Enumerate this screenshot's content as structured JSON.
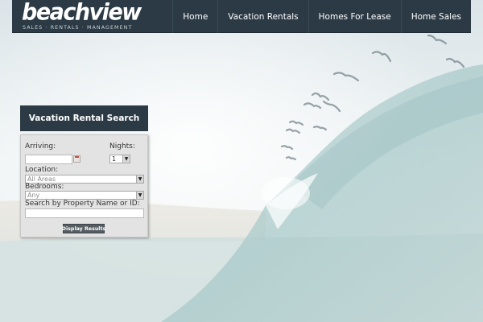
{
  "brand": {
    "logo": "beachview",
    "tagline": "SALES · RENTALS · MANAGEMENT"
  },
  "nav": {
    "items": [
      {
        "label": "Home"
      },
      {
        "label": "Vacation Rentals"
      },
      {
        "label": "Homes For Lease"
      },
      {
        "label": "Home Sales"
      }
    ]
  },
  "search": {
    "title": "Vacation Rental Search",
    "arriving_label": "Arriving:",
    "arriving_value": "",
    "nights_label": "Nights:",
    "nights_value": "1",
    "location_label": "Location:",
    "location_value": "All Areas",
    "bedrooms_label": "Bedrooms:",
    "bedrooms_value": "Any",
    "property_label": "Search by Property Name or ID:",
    "property_value": "",
    "submit_label": "Display Results"
  },
  "colors": {
    "nav_bg": "#2b3a44",
    "panel_bg": "#e3e3e3",
    "button_bg": "#555d62"
  }
}
